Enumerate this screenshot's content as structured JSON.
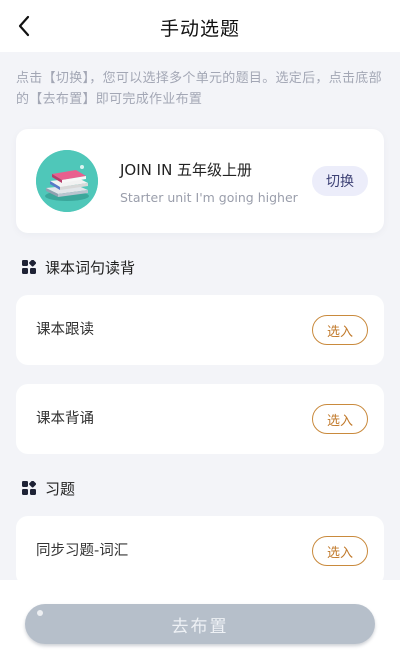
{
  "header": {
    "title": "手动选题"
  },
  "hint": {
    "text": "点击【切换】，您可以选择多个单元的题目。选定后，点击底部的【去布置】即可完成作业布置"
  },
  "book": {
    "title": "JOIN IN 五年级上册",
    "subtitle": "Starter unit I'm going higher",
    "switch_label": "切换"
  },
  "sections": [
    {
      "label": "课本词句读背",
      "items": [
        {
          "label": "课本跟读",
          "action": "选入"
        },
        {
          "label": "课本背诵",
          "action": "选入"
        }
      ]
    },
    {
      "label": "习题",
      "items": [
        {
          "label": "同步习题-词汇",
          "action": "选入"
        }
      ]
    }
  ],
  "footer": {
    "assign_label": "去布置"
  },
  "colors": {
    "background": "#f3f4f8",
    "switch_bg": "#ecedfa",
    "pick_accent": "#c1792a",
    "assign_disabled": "#b6bfca",
    "avatar_bg": "#4fc7b9"
  }
}
